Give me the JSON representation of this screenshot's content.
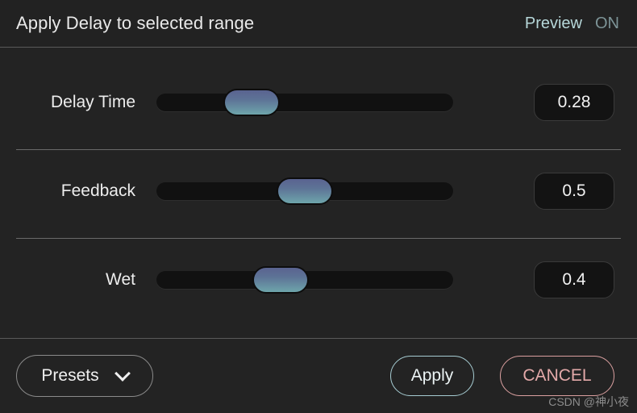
{
  "header": {
    "title": "Apply Delay to selected range",
    "preview_label": "Preview",
    "preview_state": "ON"
  },
  "params": [
    {
      "label": "Delay Time",
      "value": "0.28",
      "fraction": 0.28
    },
    {
      "label": "Feedback",
      "value": "0.5",
      "fraction": 0.5
    },
    {
      "label": "Wet",
      "value": "0.4",
      "fraction": 0.4
    }
  ],
  "footer": {
    "presets_label": "Presets",
    "apply_label": "Apply",
    "cancel_label": "CANCEL"
  },
  "watermark": "CSDN @神小夜",
  "colors": {
    "background": "#232323",
    "track": "#111111",
    "handle_top": "#5a6390",
    "handle_bottom": "#6ea5ab",
    "preview_label": "#b7d8da",
    "preview_state": "#7d9497",
    "apply_border": "#a6ccd2",
    "cancel_border": "#dba0a0",
    "cancel_text": "#e3a9a9",
    "divider": "#6a6a6a"
  }
}
